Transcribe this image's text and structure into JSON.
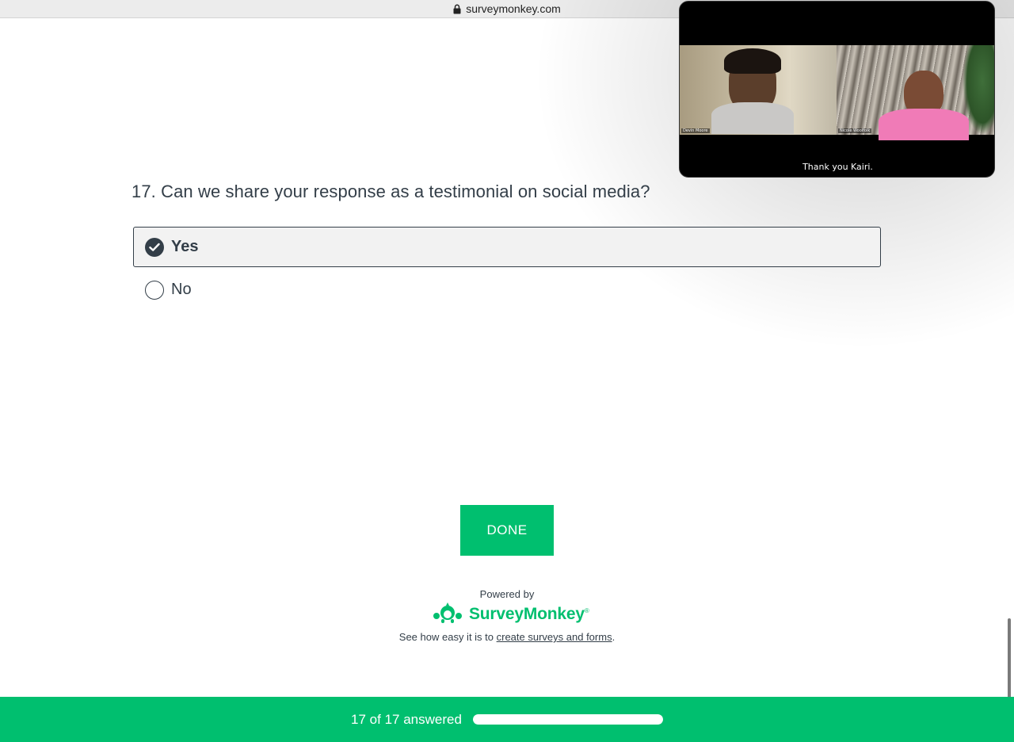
{
  "browser": {
    "url": "surveymonkey.com"
  },
  "question": {
    "number_and_text": "17. Can we share your response as a testimonial on social media?",
    "options": [
      {
        "label": "Yes",
        "selected": true
      },
      {
        "label": "No",
        "selected": false
      }
    ]
  },
  "done_button": {
    "label": "DONE"
  },
  "footer": {
    "powered_by": "Powered by",
    "brand_name": "SurveyMonkey",
    "tagline_prefix": "See how easy it is to ",
    "tagline_link": "create surveys and forms",
    "tagline_suffix": "."
  },
  "progress": {
    "text": "17 of 17 answered",
    "answered": 17,
    "total": 17
  },
  "video_call": {
    "participant_left": "Devin Moore",
    "participant_right": "Nicole Woolfolk",
    "caption": "Thank you Kairi."
  },
  "colors": {
    "brand_green": "#00bf6f",
    "text_dark": "#333e48"
  }
}
